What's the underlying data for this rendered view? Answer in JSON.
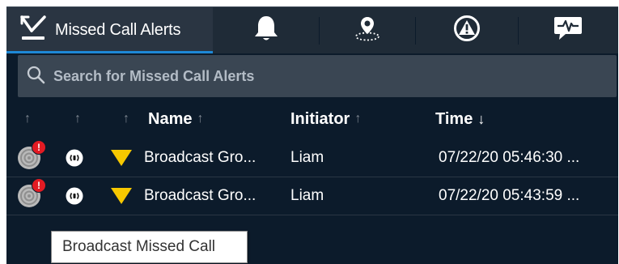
{
  "tabs": [
    {
      "label": "Missed Call Alerts",
      "icon": "missed-call-icon",
      "active": true
    },
    {
      "label": "",
      "icon": "bell-icon",
      "active": false
    },
    {
      "label": "",
      "icon": "location-pin-icon",
      "active": false
    },
    {
      "label": "",
      "icon": "warning-icon",
      "active": false
    },
    {
      "label": "",
      "icon": "heartbeat-chat-icon",
      "active": false
    }
  ],
  "search": {
    "placeholder": "Search for Missed Call Alerts",
    "value": ""
  },
  "columns": {
    "name": "Name",
    "initiator": "Initiator",
    "time": "Time",
    "sort_up": "↑",
    "sort_down": "↓"
  },
  "rows": [
    {
      "name": "Broadcast Gro...",
      "initiator": "Liam",
      "time": "07/22/20 05:46:30 ..."
    },
    {
      "name": "Broadcast Gro...",
      "initiator": "Liam",
      "time": "07/22/20 05:43:59 ..."
    }
  ],
  "badge_text": "!",
  "tooltip": {
    "text": "Broadcast Missed Call"
  },
  "colors": {
    "panel_bg": "#0c1b2b",
    "tab_active_bg": "#2a3542",
    "tab_accent": "#1e88d6",
    "alert_red": "#e31b23",
    "priority_yellow": "#f7c800"
  }
}
